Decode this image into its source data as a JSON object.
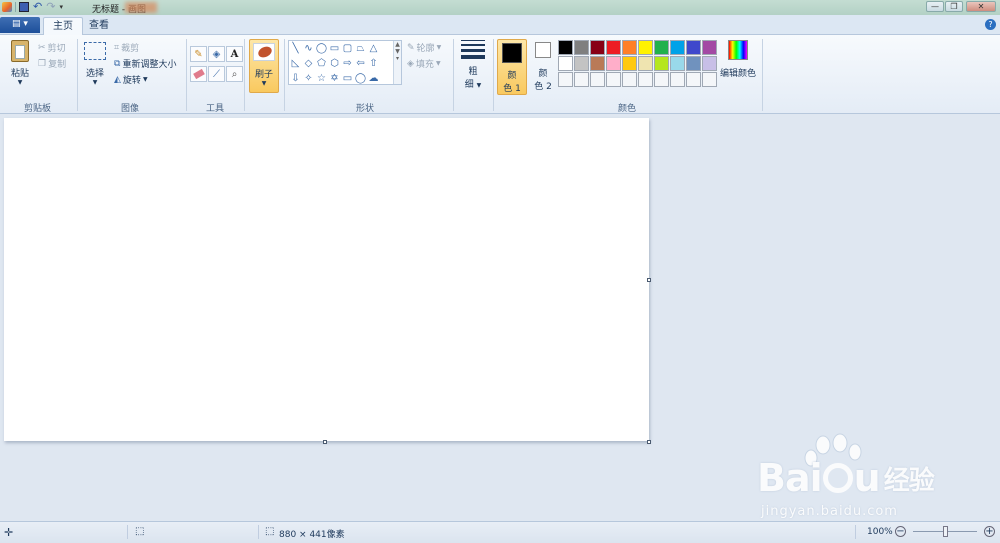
{
  "window": {
    "title": "无标题 - 画图",
    "buttons": [
      "—",
      "❐",
      "✕"
    ]
  },
  "tabs": {
    "file_label": "▤ ▾",
    "items": [
      {
        "label": "主页"
      },
      {
        "label": "查看"
      }
    ],
    "help": "?"
  },
  "ribbon": {
    "clipboard": {
      "paste": "粘贴",
      "cut": "剪切",
      "copy": "复制",
      "group": "剪贴板"
    },
    "image": {
      "select": "选择",
      "crop": "裁剪",
      "resize": "重新调整大小",
      "rotate": "旋转",
      "group": "图像"
    },
    "tools": {
      "group": "工具"
    },
    "brushes": {
      "label": "刷子"
    },
    "shapes": {
      "outline": "轮廓",
      "fill": "填充",
      "group": "形状"
    },
    "size": {
      "label_1": "粗",
      "label_2": "细"
    },
    "colors": {
      "color1_a": "颜",
      "color1_b": "色 1",
      "color2_a": "颜",
      "color2_b": "色 2",
      "edit": "编辑颜色",
      "group": "颜色",
      "color1": "#000000",
      "color2": "#ffffff",
      "palette": [
        "#000000",
        "#7f7f7f",
        "#880015",
        "#ed1c24",
        "#ff7f27",
        "#fff200",
        "#22b14c",
        "#00a2e8",
        "#3f48cc",
        "#a349a4",
        "#ffffff",
        "#c3c3c3",
        "#b97a57",
        "#ffaec9",
        "#ffc90e",
        "#efe4b0",
        "#b5e61d",
        "#99d9ea",
        "#7092be",
        "#c8bfe7",
        "#f4f6f9",
        "#f4f6f9",
        "#f4f6f9",
        "#f4f6f9",
        "#f4f6f9",
        "#f4f6f9",
        "#f4f6f9",
        "#f4f6f9",
        "#f4f6f9",
        "#f4f6f9"
      ]
    }
  },
  "status": {
    "canvas_size": "880 × 441像素",
    "zoom": "100%"
  },
  "watermark": {
    "brand": "Bai",
    "brand_end": "u",
    "suffix": "经验",
    "url": "jingyan.baidu.com"
  }
}
